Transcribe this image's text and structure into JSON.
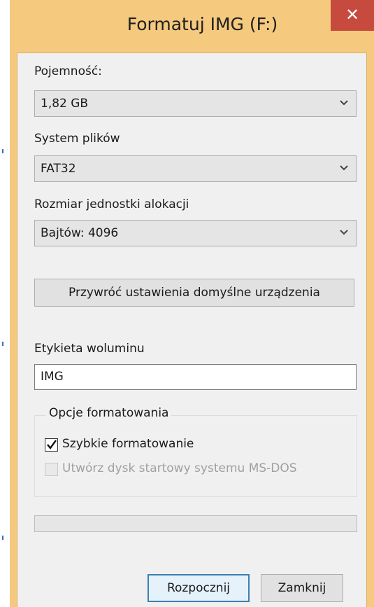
{
  "window": {
    "title": "Formatuj IMG (F:)",
    "close_glyph": "✕"
  },
  "capacity": {
    "label": "Pojemność:",
    "value": "1,82 GB"
  },
  "file_system": {
    "label": "System plików",
    "value": "FAT32"
  },
  "allocation": {
    "label": "Rozmiar jednostki alokacji",
    "value": "Bajtów: 4096"
  },
  "restore_defaults_label": "Przywróć ustawienia domyślne urządzenia",
  "volume_label": {
    "label": "Etykieta woluminu",
    "value": "IMG"
  },
  "format_options": {
    "title": "Opcje formatowania",
    "quick_format": {
      "label": "Szybkie formatowanie",
      "checked": true,
      "enabled": true
    },
    "ms_dos_startup": {
      "label": "Utwórz dysk startowy systemu MS-DOS",
      "checked": false,
      "enabled": false
    }
  },
  "progress": {
    "fraction": 0
  },
  "buttons": {
    "start": "Rozpocznij",
    "close": "Zamknij"
  },
  "colors": {
    "title_bar": "#f5c97e",
    "close_button": "#c74a3e",
    "dialog_background": "#f0f0f0",
    "default_button_border": "#3c7fb1"
  },
  "icons": {
    "close": "close-icon",
    "dropdown": "chevron-down-icon",
    "check": "checkmark-icon"
  }
}
